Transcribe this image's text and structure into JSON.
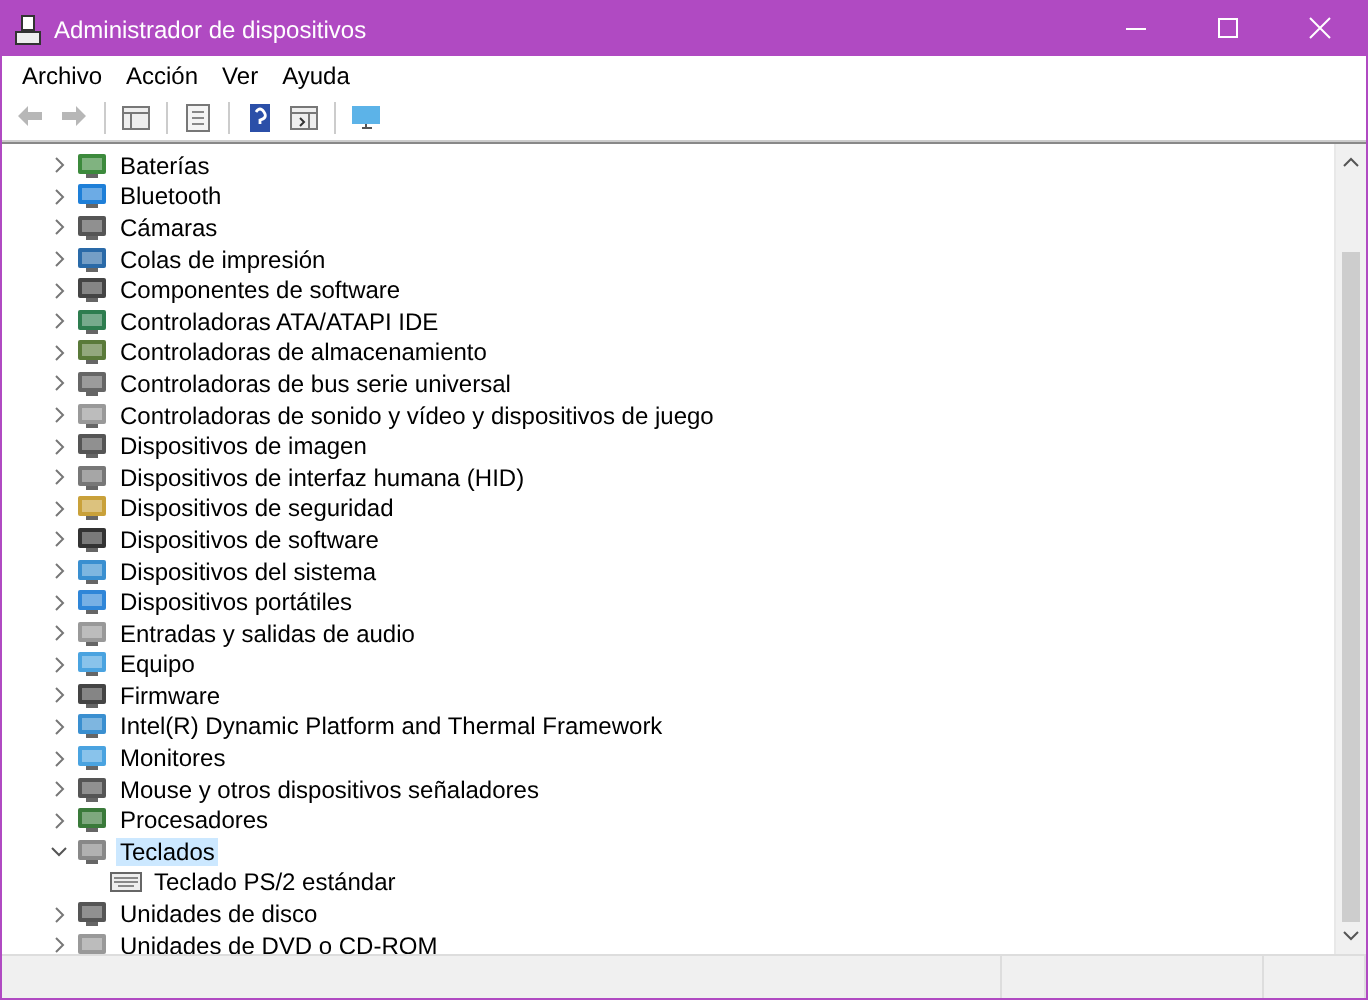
{
  "window": {
    "title": "Administrador de dispositivos"
  },
  "menu": [
    {
      "label": "Archivo"
    },
    {
      "label": "Acción"
    },
    {
      "label": "Ver"
    },
    {
      "label": "Ayuda"
    }
  ],
  "toolbar": [
    {
      "kind": "back",
      "disabled": true
    },
    {
      "kind": "forward",
      "disabled": true
    },
    {
      "kind": "separator"
    },
    {
      "kind": "pane",
      "disabled": false
    },
    {
      "kind": "separator"
    },
    {
      "kind": "properties",
      "disabled": false
    },
    {
      "kind": "separator"
    },
    {
      "kind": "help",
      "disabled": false
    },
    {
      "kind": "view",
      "disabled": false
    },
    {
      "kind": "separator"
    },
    {
      "kind": "monitor",
      "disabled": false
    }
  ],
  "tree": [
    {
      "label": "Baterías",
      "expanded": false,
      "selected": false
    },
    {
      "label": "Bluetooth",
      "expanded": false,
      "selected": false
    },
    {
      "label": "Cámaras",
      "expanded": false,
      "selected": false
    },
    {
      "label": "Colas de impresión",
      "expanded": false,
      "selected": false
    },
    {
      "label": "Componentes de software",
      "expanded": false,
      "selected": false
    },
    {
      "label": "Controladoras ATA/ATAPI IDE",
      "expanded": false,
      "selected": false
    },
    {
      "label": "Controladoras de almacenamiento",
      "expanded": false,
      "selected": false
    },
    {
      "label": "Controladoras de bus serie universal",
      "expanded": false,
      "selected": false
    },
    {
      "label": "Controladoras de sonido y vídeo y dispositivos de juego",
      "expanded": false,
      "selected": false
    },
    {
      "label": "Dispositivos de imagen",
      "expanded": false,
      "selected": false
    },
    {
      "label": "Dispositivos de interfaz humana (HID)",
      "expanded": false,
      "selected": false
    },
    {
      "label": "Dispositivos de seguridad",
      "expanded": false,
      "selected": false
    },
    {
      "label": "Dispositivos de software",
      "expanded": false,
      "selected": false
    },
    {
      "label": "Dispositivos del sistema",
      "expanded": false,
      "selected": false
    },
    {
      "label": "Dispositivos portátiles",
      "expanded": false,
      "selected": false
    },
    {
      "label": "Entradas y salidas de audio",
      "expanded": false,
      "selected": false
    },
    {
      "label": "Equipo",
      "expanded": false,
      "selected": false
    },
    {
      "label": "Firmware",
      "expanded": false,
      "selected": false
    },
    {
      "label": "Intel(R) Dynamic Platform and Thermal Framework",
      "expanded": false,
      "selected": false
    },
    {
      "label": "Monitores",
      "expanded": false,
      "selected": false
    },
    {
      "label": "Mouse y otros dispositivos señaladores",
      "expanded": false,
      "selected": false
    },
    {
      "label": "Procesadores",
      "expanded": false,
      "selected": false
    },
    {
      "label": "Teclados",
      "expanded": true,
      "selected": true,
      "children": [
        {
          "label": "Teclado PS/2 estándar",
          "selected": false
        }
      ]
    },
    {
      "label": "Unidades de disco",
      "expanded": false,
      "selected": false
    },
    {
      "label": "Unidades de DVD o CD-ROM",
      "expanded": false,
      "selected": false
    }
  ]
}
